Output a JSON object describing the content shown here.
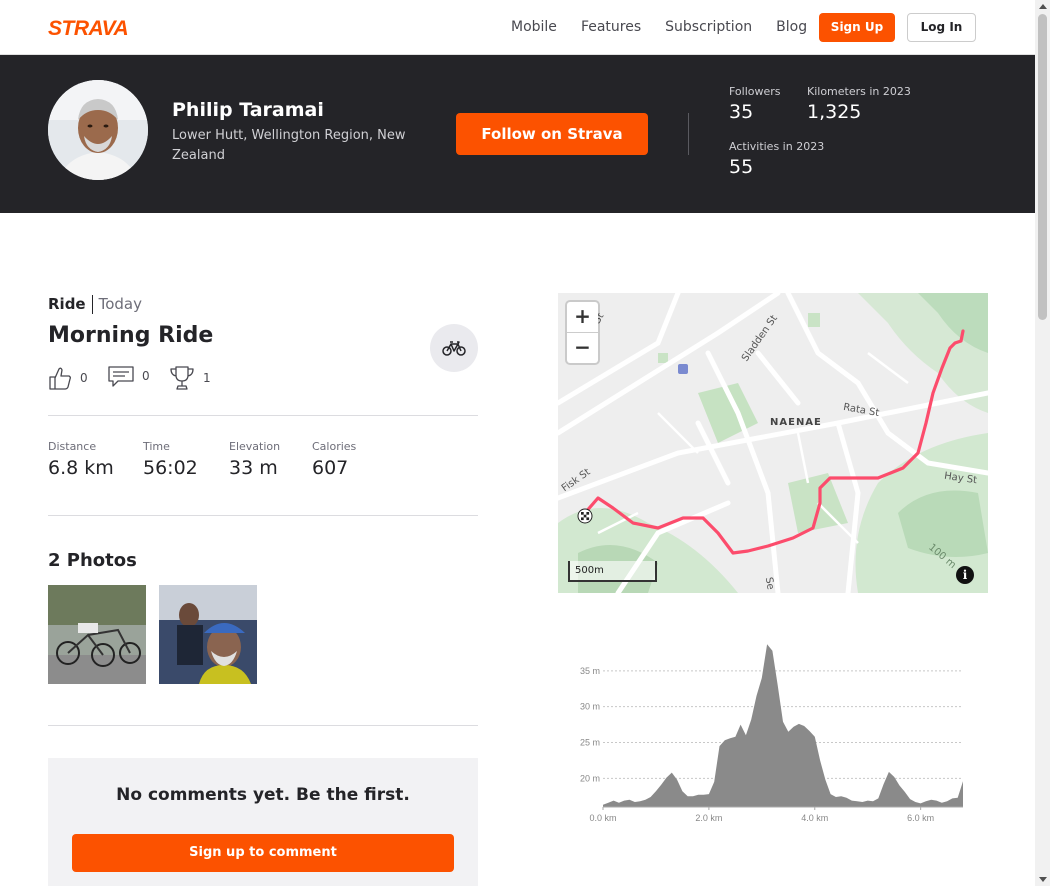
{
  "nav": {
    "brand": "STRAVA",
    "links": [
      "Mobile",
      "Features",
      "Subscription",
      "Blog"
    ],
    "signup": "Sign Up",
    "login": "Log In"
  },
  "athlete": {
    "name": "Philip Taramai",
    "location": "Lower Hutt, Wellington Region, New Zealand",
    "follow": "Follow on Strava",
    "stats": {
      "followers_label": "Followers",
      "followers": "35",
      "km_label": "Kilometers in 2023",
      "km": "1,325",
      "activities_label": "Activities in 2023",
      "activities": "55"
    }
  },
  "activity": {
    "type": "Ride",
    "date": "Today",
    "title": "Morning Ride",
    "kudos": "0",
    "comments": "0",
    "achievements": "1",
    "stats": [
      {
        "label": "Distance",
        "value": "6.8 km"
      },
      {
        "label": "Time",
        "value": "56:02"
      },
      {
        "label": "Elevation",
        "value": "33 m"
      },
      {
        "label": "Calories",
        "value": "607"
      }
    ],
    "photos_title": "2 Photos",
    "no_comments": "No comments yet. Be the first.",
    "comment_button": "Sign up to comment"
  },
  "map": {
    "zoom_in": "+",
    "zoom_out": "−",
    "scale": "500m",
    "info": "i",
    "labels": [
      "Sladden St",
      "Rata St",
      "NAENAE",
      "Hay St",
      "Fisk St",
      "St",
      "100 m",
      "Se"
    ]
  },
  "colors": {
    "brand": "#fc5200",
    "header_bg": "#242428",
    "route": "#fc4c6c",
    "elevation_fill": "#8a8a8a"
  },
  "chart_data": {
    "type": "area",
    "x": [
      0.0,
      0.1,
      0.2,
      0.3,
      0.4,
      0.5,
      0.6,
      0.7,
      0.8,
      0.9,
      1.0,
      1.1,
      1.2,
      1.3,
      1.4,
      1.5,
      1.6,
      1.7,
      1.8,
      1.9,
      2.0,
      2.1,
      2.2,
      2.3,
      2.4,
      2.5,
      2.6,
      2.7,
      2.8,
      2.9,
      3.0,
      3.1,
      3.2,
      3.3,
      3.4,
      3.5,
      3.6,
      3.7,
      3.8,
      3.9,
      4.0,
      4.1,
      4.2,
      4.3,
      4.4,
      4.5,
      4.6,
      4.7,
      4.8,
      4.9,
      5.0,
      5.1,
      5.2,
      5.3,
      5.4,
      5.5,
      5.6,
      5.7,
      5.8,
      5.9,
      6.0,
      6.1,
      6.2,
      6.3,
      6.4,
      6.5,
      6.6,
      6.7,
      6.8
    ],
    "y": [
      16.3,
      16.6,
      16.9,
      16.6,
      16.9,
      17.0,
      16.7,
      16.8,
      17.0,
      17.4,
      18.2,
      19.1,
      20.1,
      20.8,
      19.8,
      18.2,
      17.5,
      17.5,
      17.7,
      17.7,
      17.8,
      19.5,
      24.5,
      25.3,
      25.6,
      25.8,
      27.5,
      26.0,
      28.2,
      31.5,
      34.0,
      38.7,
      37.8,
      33.0,
      27.9,
      26.5,
      27.2,
      27.6,
      27.3,
      26.6,
      25.8,
      22.5,
      19.8,
      17.8,
      17.4,
      17.5,
      17.3,
      16.9,
      16.8,
      16.7,
      16.9,
      16.8,
      17.2,
      19.2,
      20.9,
      20.2,
      19.0,
      18.1,
      17.1,
      16.7,
      16.5,
      16.8,
      17.0,
      16.9,
      16.6,
      16.8,
      17.2,
      17.3,
      19.6
    ],
    "xticks": [
      "0.0 km",
      "2.0 km",
      "4.0 km",
      "6.0 km"
    ],
    "yticks": [
      "20 m",
      "25 m",
      "30 m",
      "35 m"
    ],
    "xlim": [
      0,
      6.8
    ],
    "ylim": [
      16,
      40
    ],
    "grid": true
  }
}
